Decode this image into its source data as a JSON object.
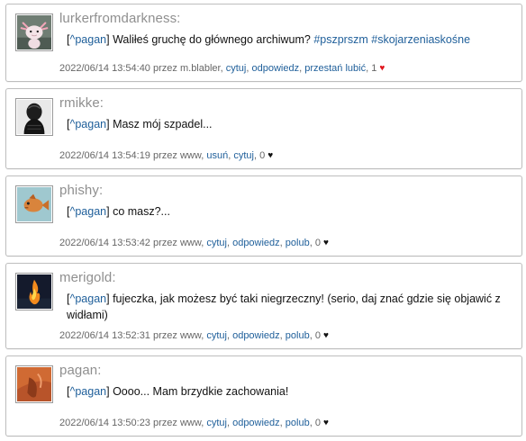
{
  "comments": [
    {
      "author": "lurkerfromdarkness:",
      "reply_to": "^pagan",
      "text_before": " Waliłeś gruchę do głównego archiwum? ",
      "tags": [
        "#pszprszm",
        "#skojarzeniaskośne"
      ],
      "timestamp": "2022/06/14 13:54:40",
      "by_prefix": "przez",
      "by": "m.blabler",
      "actions": [
        "cytuj",
        "odpowiedz",
        "przestań lubić"
      ],
      "likes": "1",
      "heart_color": "#e0161e",
      "avatar_icon": "axolotl-avatar-icon"
    },
    {
      "author": "rmikke:",
      "reply_to": "^pagan",
      "text": " Masz mój szpadel...",
      "timestamp": "2022/06/14 13:54:19",
      "by_prefix": "przez",
      "by": "www",
      "actions": [
        "usuń",
        "cytuj"
      ],
      "likes": "0",
      "heart_color": "#111111",
      "avatar_icon": "dark-figure-avatar-icon"
    },
    {
      "author": "phishy:",
      "reply_to": "^pagan",
      "text": " co masz?...",
      "timestamp": "2022/06/14 13:53:42",
      "by_prefix": "przez",
      "by": "www",
      "actions": [
        "cytuj",
        "odpowiedz",
        "polub"
      ],
      "likes": "0",
      "heart_color": "#111111",
      "avatar_icon": "fish-avatar-icon"
    },
    {
      "author": "merigold:",
      "reply_to": "^pagan",
      "text": " fujeczka, jak możesz być taki niegrzeczny! (serio, daj znać gdzie się objawić z widłami)",
      "timestamp": "2022/06/14 13:52:31",
      "by_prefix": "przez",
      "by": "www",
      "actions": [
        "cytuj",
        "odpowiedz",
        "polub"
      ],
      "likes": "0",
      "heart_color": "#111111",
      "avatar_icon": "fire-avatar-icon"
    },
    {
      "author": "pagan:",
      "reply_to": "^pagan",
      "text": " Oooo... Mam brzydkie zachowania!",
      "timestamp": "2022/06/14 13:50:23",
      "by_prefix": "przez",
      "by": "www",
      "actions": [
        "cytuj",
        "odpowiedz",
        "polub"
      ],
      "likes": "0",
      "heart_color": "#111111",
      "avatar_icon": "photo-avatar-icon"
    }
  ],
  "separator": ", ",
  "heart_glyph": "♥",
  "bracket_open": "[",
  "bracket_close": "]"
}
